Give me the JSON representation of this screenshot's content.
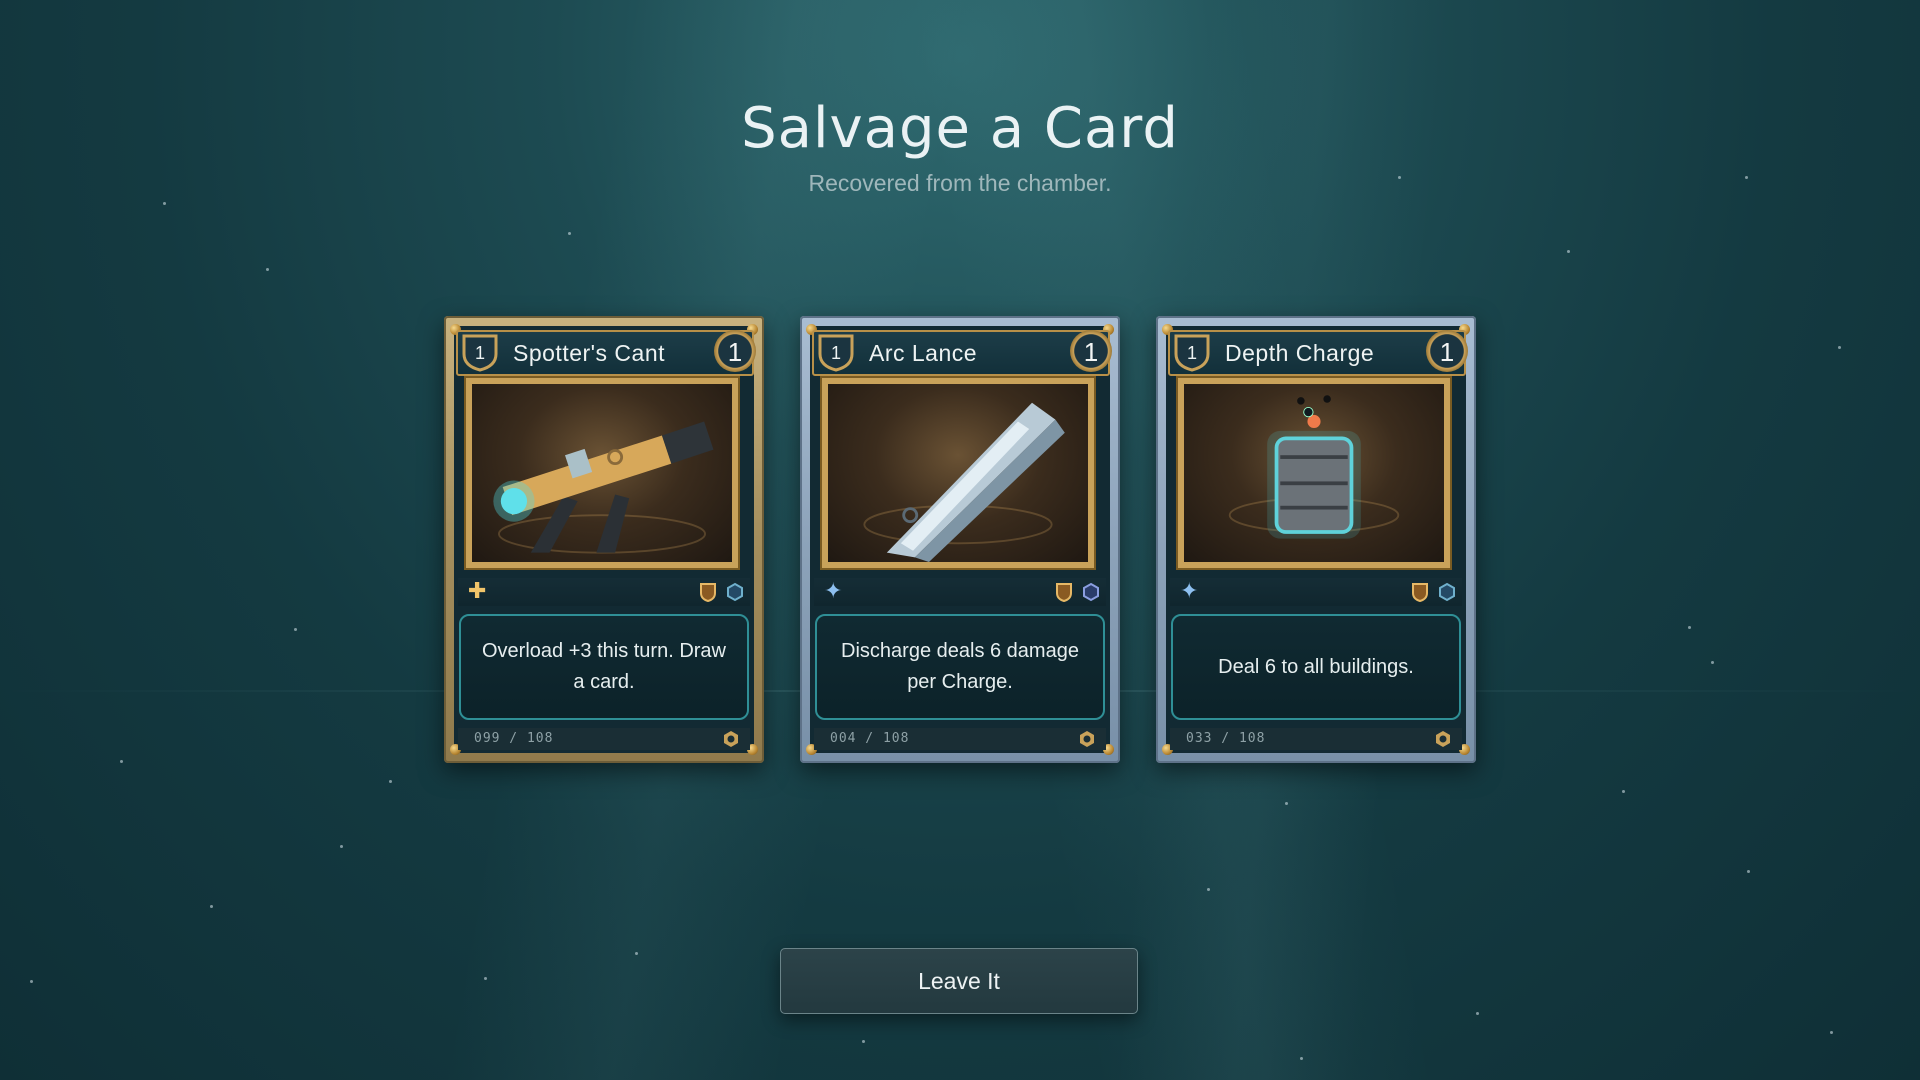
{
  "header": {
    "title": "Salvage a Card",
    "subtitle": "Recovered from the chamber."
  },
  "cards": [
    {
      "name": "Spotter's Cant",
      "level": "1",
      "cost": "1",
      "description": "Overload +3 this turn. Draw a card.",
      "serial": "099 / 108",
      "frame": "gold",
      "type_icon": "plus-icon",
      "art": "telescope"
    },
    {
      "name": "Arc Lance",
      "level": "1",
      "cost": "1",
      "description": "Discharge deals 6 damage per Charge.",
      "serial": "004 / 108",
      "frame": "steel",
      "type_icon": "sparkle-icon",
      "art": "lance"
    },
    {
      "name": "Depth Charge",
      "level": "1",
      "cost": "1",
      "description": "Deal 6 to all buildings.",
      "serial": "033 / 108",
      "frame": "steel",
      "type_icon": "sparkle-icon",
      "art": "barrel"
    }
  ],
  "actions": {
    "leave_label": "Leave It"
  },
  "colors": {
    "gold_trim": "#c9a25a",
    "text_border": "#2f8f96",
    "background": "#1d4b52"
  }
}
